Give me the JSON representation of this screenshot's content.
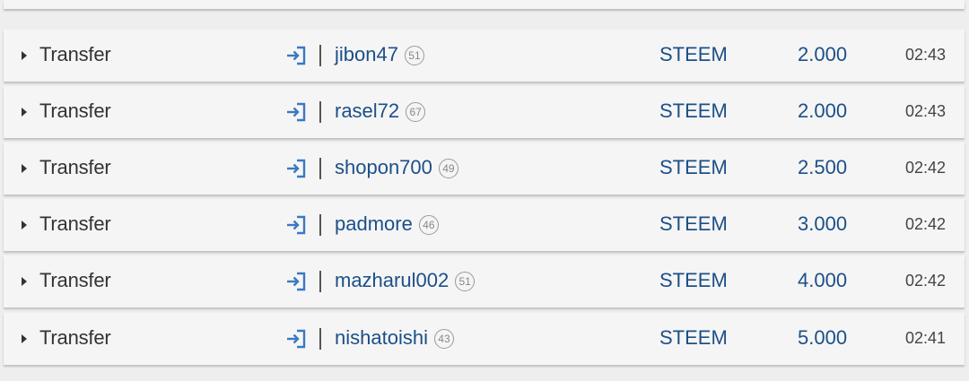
{
  "colors": {
    "link": "#1c4f88",
    "icon": "#3b78c2",
    "text": "#333333"
  },
  "rows": [
    {
      "type": "Transfer",
      "icon": "sign-in-icon",
      "account": "jibon47",
      "reputation": "51",
      "asset": "STEEM",
      "amount": "2.000",
      "time": "02:43"
    },
    {
      "type": "Transfer",
      "icon": "sign-in-icon",
      "account": "rasel72",
      "reputation": "67",
      "asset": "STEEM",
      "amount": "2.000",
      "time": "02:43"
    },
    {
      "type": "Transfer",
      "icon": "sign-in-icon",
      "account": "shopon700",
      "reputation": "49",
      "asset": "STEEM",
      "amount": "2.500",
      "time": "02:42"
    },
    {
      "type": "Transfer",
      "icon": "sign-in-icon",
      "account": "padmore",
      "reputation": "46",
      "asset": "STEEM",
      "amount": "3.000",
      "time": "02:42"
    },
    {
      "type": "Transfer",
      "icon": "sign-in-icon",
      "account": "mazharul002",
      "reputation": "51",
      "asset": "STEEM",
      "amount": "4.000",
      "time": "02:42"
    },
    {
      "type": "Transfer",
      "icon": "sign-in-icon",
      "account": "nishatoishi",
      "reputation": "43",
      "asset": "STEEM",
      "amount": "5.000",
      "time": "02:41"
    }
  ]
}
